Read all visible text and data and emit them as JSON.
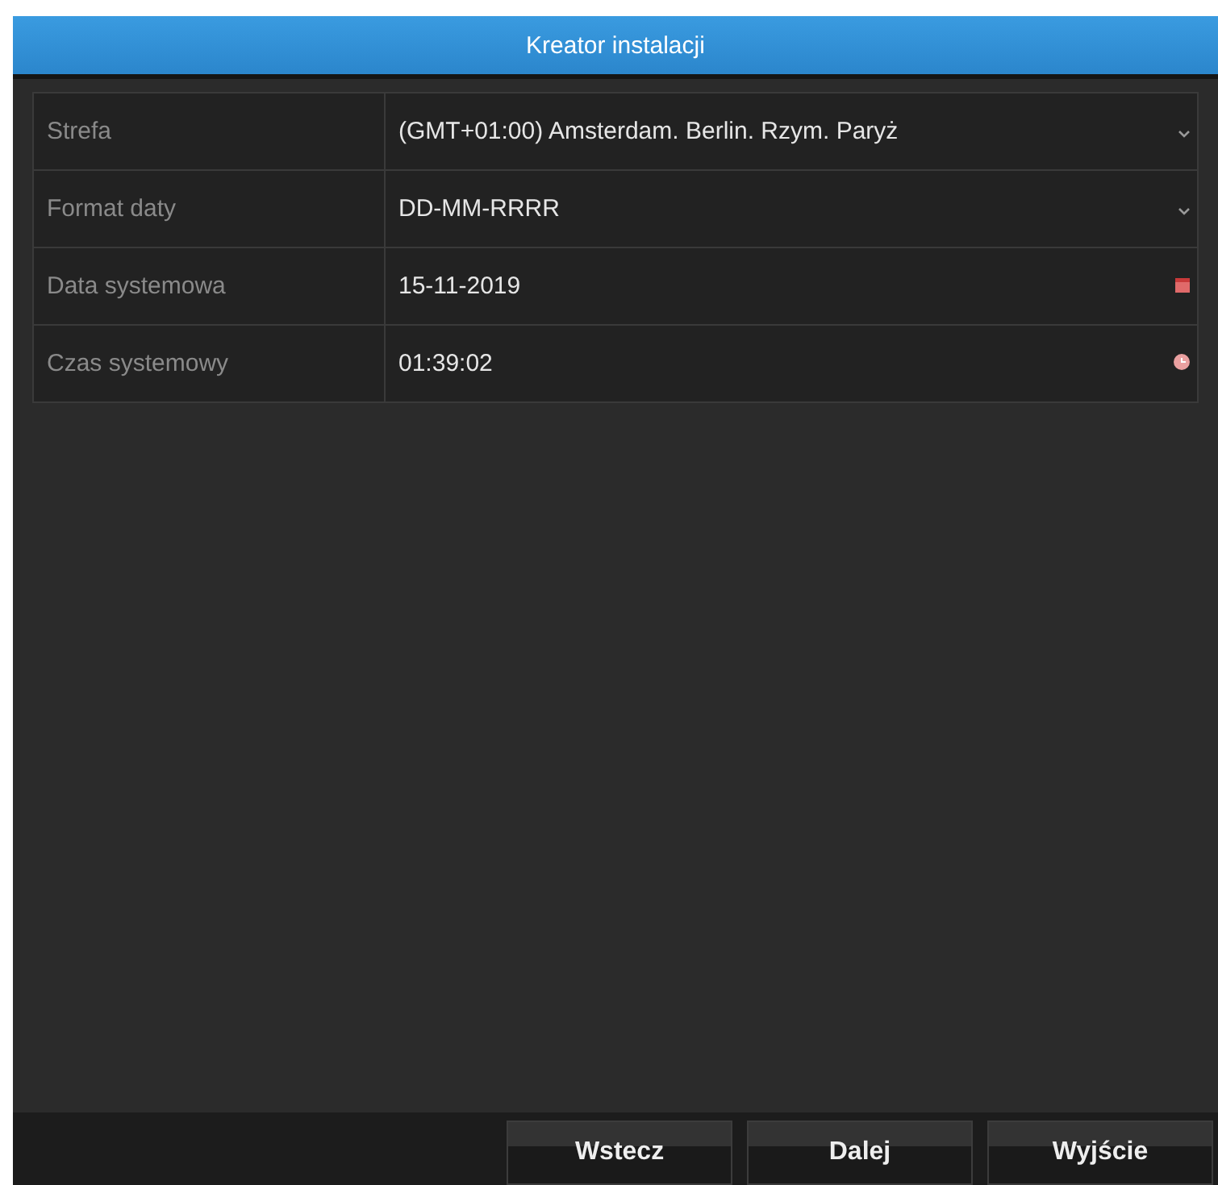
{
  "window": {
    "title": "Kreator instalacji"
  },
  "fields": [
    {
      "label": "Strefa",
      "value": "(GMT+01:00) Amsterdam. Berlin. Rzym. Paryż",
      "kind": "select"
    },
    {
      "label": "Format daty",
      "value": "DD-MM-RRRR",
      "kind": "select"
    },
    {
      "label": "Data systemowa",
      "value": "15-11-2019",
      "kind": "date"
    },
    {
      "label": "Czas systemowy",
      "value": "01:39:02",
      "kind": "time"
    }
  ],
  "buttons": [
    "Wstecz",
    "Dalej",
    "Wyjście"
  ]
}
